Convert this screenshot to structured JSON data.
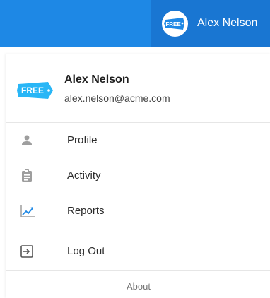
{
  "colors": {
    "topbar_bg": "#1e88e5",
    "topbar_user_bg": "#1976d2",
    "logo_blue": "#29b6f6",
    "icon_grey": "#9e9e9e",
    "reports_blue": "#1e88e5"
  },
  "topbar": {
    "user_name": "Alex Nelson",
    "avatar_badge": "FREE",
    "avatar_icon": "free-badge-icon"
  },
  "dropdown": {
    "header": {
      "badge": "FREE",
      "badge_icon": "free-badge-icon",
      "name": "Alex Nelson",
      "email": "alex.nelson@acme.com"
    },
    "items": [
      {
        "label": "Profile",
        "icon": "person-icon"
      },
      {
        "label": "Activity",
        "icon": "clipboard-icon"
      },
      {
        "label": "Reports",
        "icon": "line-chart-icon"
      }
    ],
    "logout": {
      "label": "Log Out",
      "icon": "logout-icon"
    },
    "about": "About"
  }
}
